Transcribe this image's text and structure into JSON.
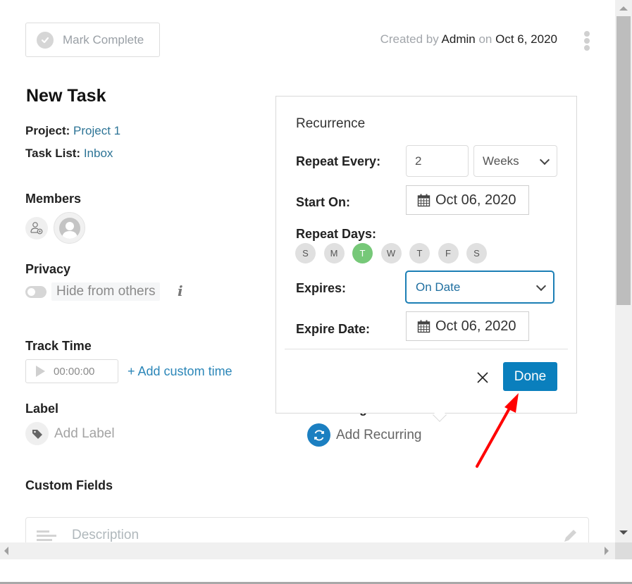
{
  "header": {
    "mark_complete_label": "Mark Complete",
    "created_by_prefix": "Created by",
    "created_by_user": "Admin",
    "created_on_prefix": "on",
    "created_date": "Oct 6, 2020"
  },
  "task": {
    "title": "New Task",
    "project_label": "Project:",
    "project_value": "Project 1",
    "task_list_label": "Task List:",
    "task_list_value": "Inbox"
  },
  "sections": {
    "members": "Members",
    "privacy": "Privacy",
    "privacy_toggle_label": "Hide from others",
    "privacy_toggle_on": false,
    "track_time": "Track Time",
    "timer_value": "00:00:00",
    "add_custom_time": "+ Add custom time",
    "label": "Label",
    "add_label": "Add Label",
    "recurring": "Recurring",
    "add_recurring": "Add Recurring",
    "custom_fields": "Custom Fields",
    "description_placeholder": "Description"
  },
  "recurrence_popover": {
    "title": "Recurrence",
    "repeat_every_label": "Repeat Every:",
    "repeat_every_value": "2",
    "repeat_unit": "Weeks",
    "start_on_label": "Start On:",
    "start_on_value": "Oct 06, 2020",
    "repeat_days_label": "Repeat Days:",
    "days": [
      {
        "label": "S",
        "active": false
      },
      {
        "label": "M",
        "active": false
      },
      {
        "label": "T",
        "active": true
      },
      {
        "label": "W",
        "active": false
      },
      {
        "label": "T",
        "active": false
      },
      {
        "label": "F",
        "active": false
      },
      {
        "label": "S",
        "active": false
      }
    ],
    "expires_label": "Expires:",
    "expires_value": "On Date",
    "expire_date_label": "Expire Date:",
    "expire_date_value": "Oct 06, 2020",
    "done_label": "Done"
  },
  "colors": {
    "accent": "#0a7fbd",
    "link": "#2d7496",
    "active_day": "#76c878",
    "annotation_arrow": "#ff0000"
  }
}
